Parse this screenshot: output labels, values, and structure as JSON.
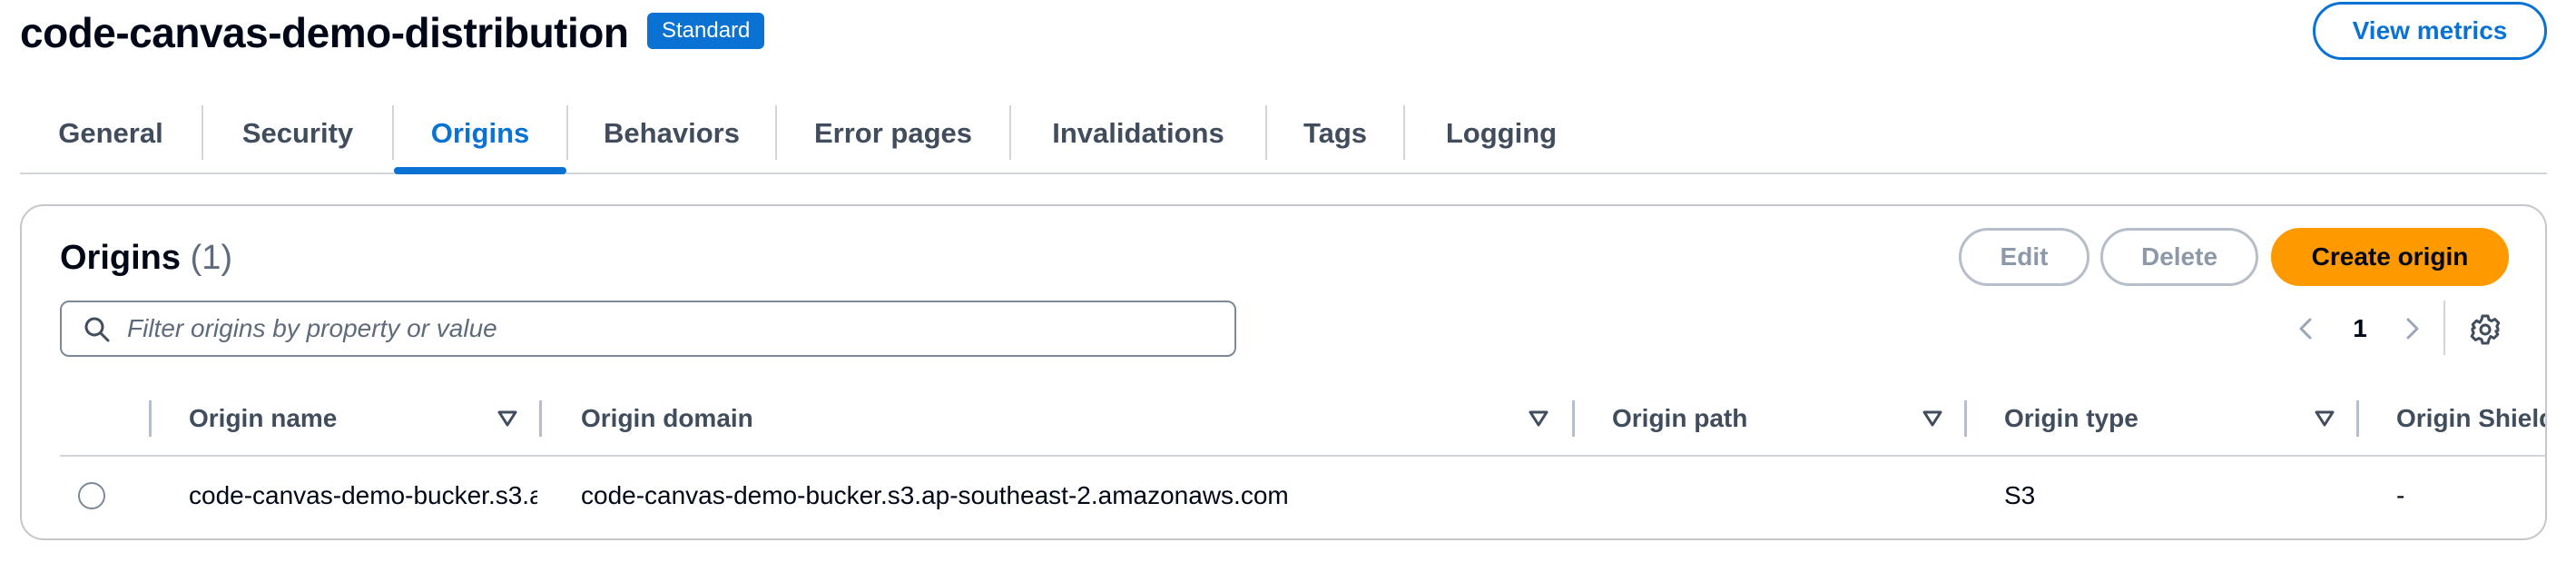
{
  "header": {
    "title": "code-canvas-demo-distribution",
    "badge": "Standard",
    "view_metrics": "View metrics"
  },
  "tabs": [
    {
      "label": "General"
    },
    {
      "label": "Security"
    },
    {
      "label": "Origins",
      "active": true
    },
    {
      "label": "Behaviors"
    },
    {
      "label": "Error pages"
    },
    {
      "label": "Invalidations"
    },
    {
      "label": "Tags"
    },
    {
      "label": "Logging"
    }
  ],
  "panel": {
    "title": "Origins",
    "count": "(1)",
    "buttons": {
      "edit": "Edit",
      "delete": "Delete",
      "create": "Create origin"
    },
    "filter_placeholder": "Filter origins by property or value",
    "page": "1"
  },
  "table": {
    "columns": [
      "Origin name",
      "Origin domain",
      "Origin path",
      "Origin type",
      "Origin Shield r"
    ],
    "rows": [
      {
        "name": "code-canvas-demo-bucker.s3.a",
        "domain": "code-canvas-demo-bucker.s3.ap-southeast-2.amazonaws.com",
        "path": "",
        "type": "S3",
        "shield": "-"
      }
    ]
  },
  "colors": {
    "accent": "#0972d3",
    "primary_button": "#ff9900"
  }
}
